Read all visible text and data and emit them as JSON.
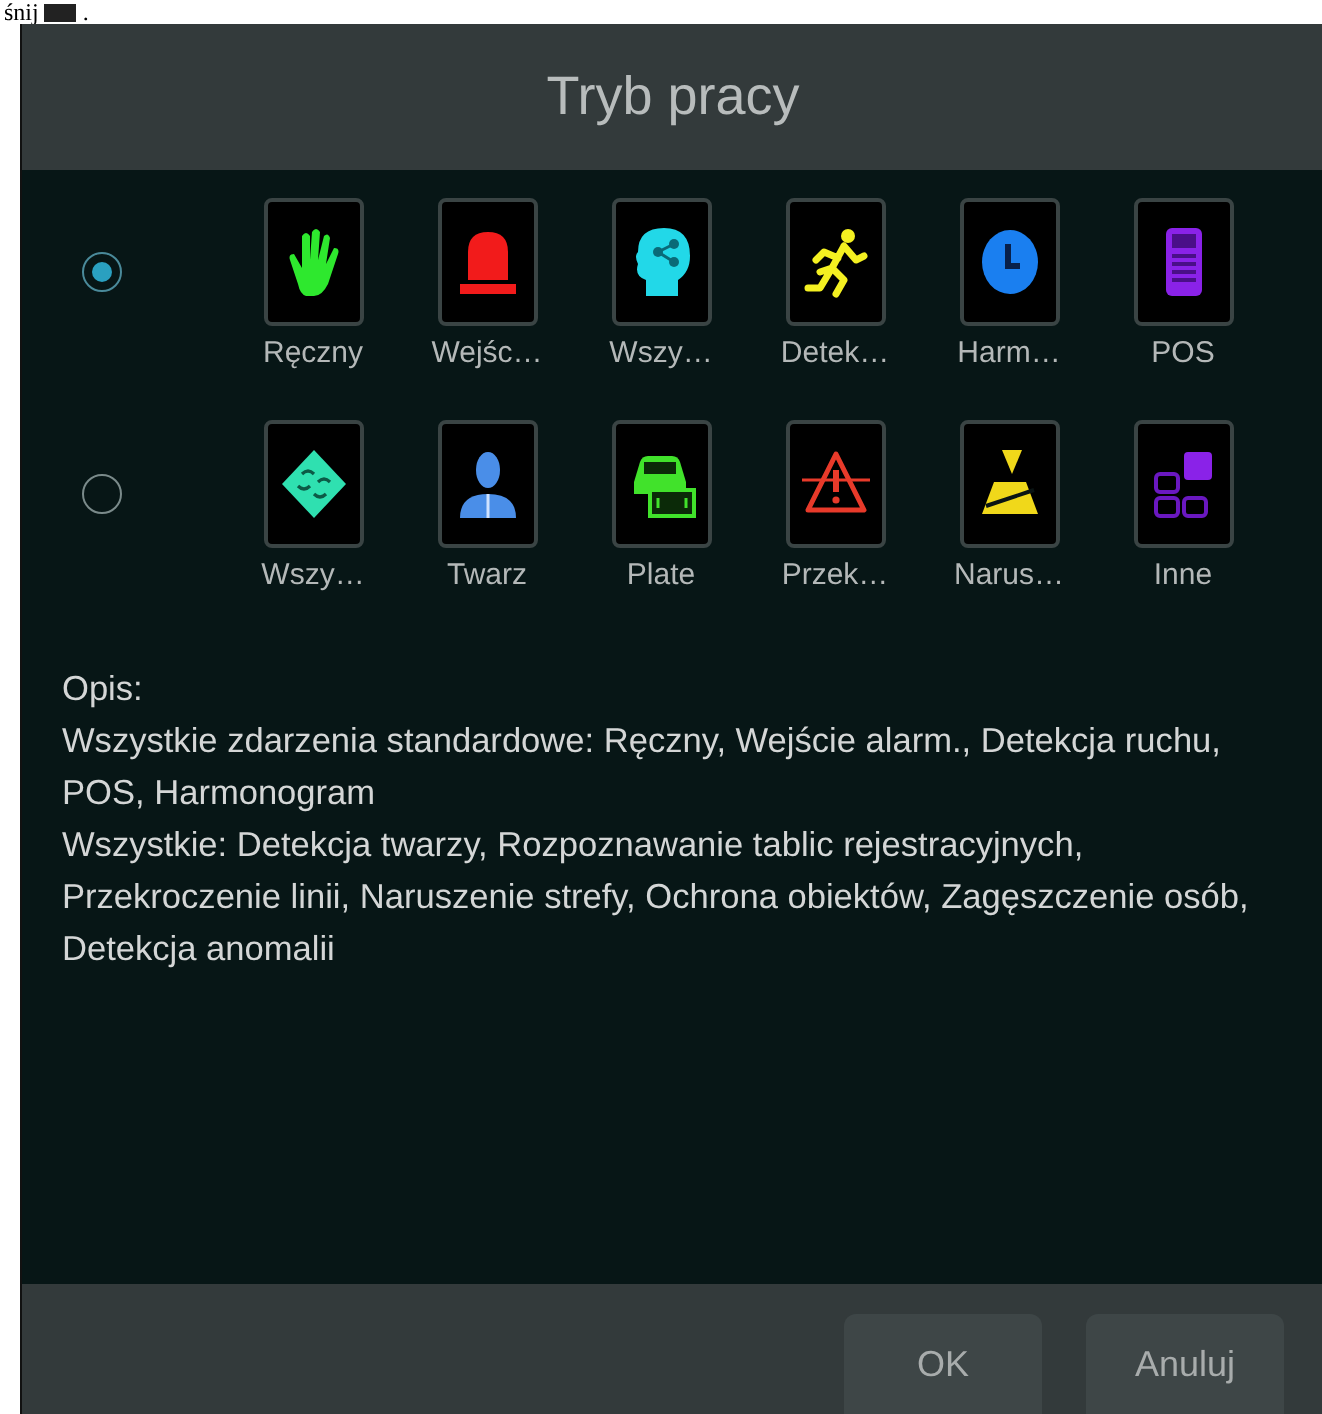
{
  "page_fragment": {
    "text": "śnij",
    "end": "."
  },
  "dialog": {
    "title": "Tryb pracy"
  },
  "modes": [
    {
      "selected": true,
      "items": [
        {
          "kind": "hand",
          "label": "Ręczny"
        },
        {
          "kind": "alarm",
          "label": "Wejśc…"
        },
        {
          "kind": "head",
          "label": "Wszy…"
        },
        {
          "kind": "run",
          "label": "Detek…"
        },
        {
          "kind": "clock",
          "label": "Harm…"
        },
        {
          "kind": "pos",
          "label": "POS"
        }
      ]
    },
    {
      "selected": false,
      "items": [
        {
          "kind": "diamond",
          "label": "Wszy…"
        },
        {
          "kind": "person",
          "label": "Twarz"
        },
        {
          "kind": "plate",
          "label": "Plate"
        },
        {
          "kind": "warning",
          "label": "Przek…"
        },
        {
          "kind": "zone",
          "label": "Narus…"
        },
        {
          "kind": "other",
          "label": "Inne"
        }
      ]
    }
  ],
  "description": {
    "heading": "Opis:",
    "lines": [
      "Wszystkie zdarzenia standardowe: Ręczny, Wejście alarm., Detekcja ruchu, POS, Harmonogram",
      "Wszystkie: Detekcja twarzy, Rozpoznawanie tablic rejestracyjnych, Przekroczenie linii, Naruszenie strefy, Ochrona obiektów, Zagęszczenie osób, Detekcja anomalii"
    ]
  },
  "buttons": [
    "OK",
    "Anuluj"
  ]
}
